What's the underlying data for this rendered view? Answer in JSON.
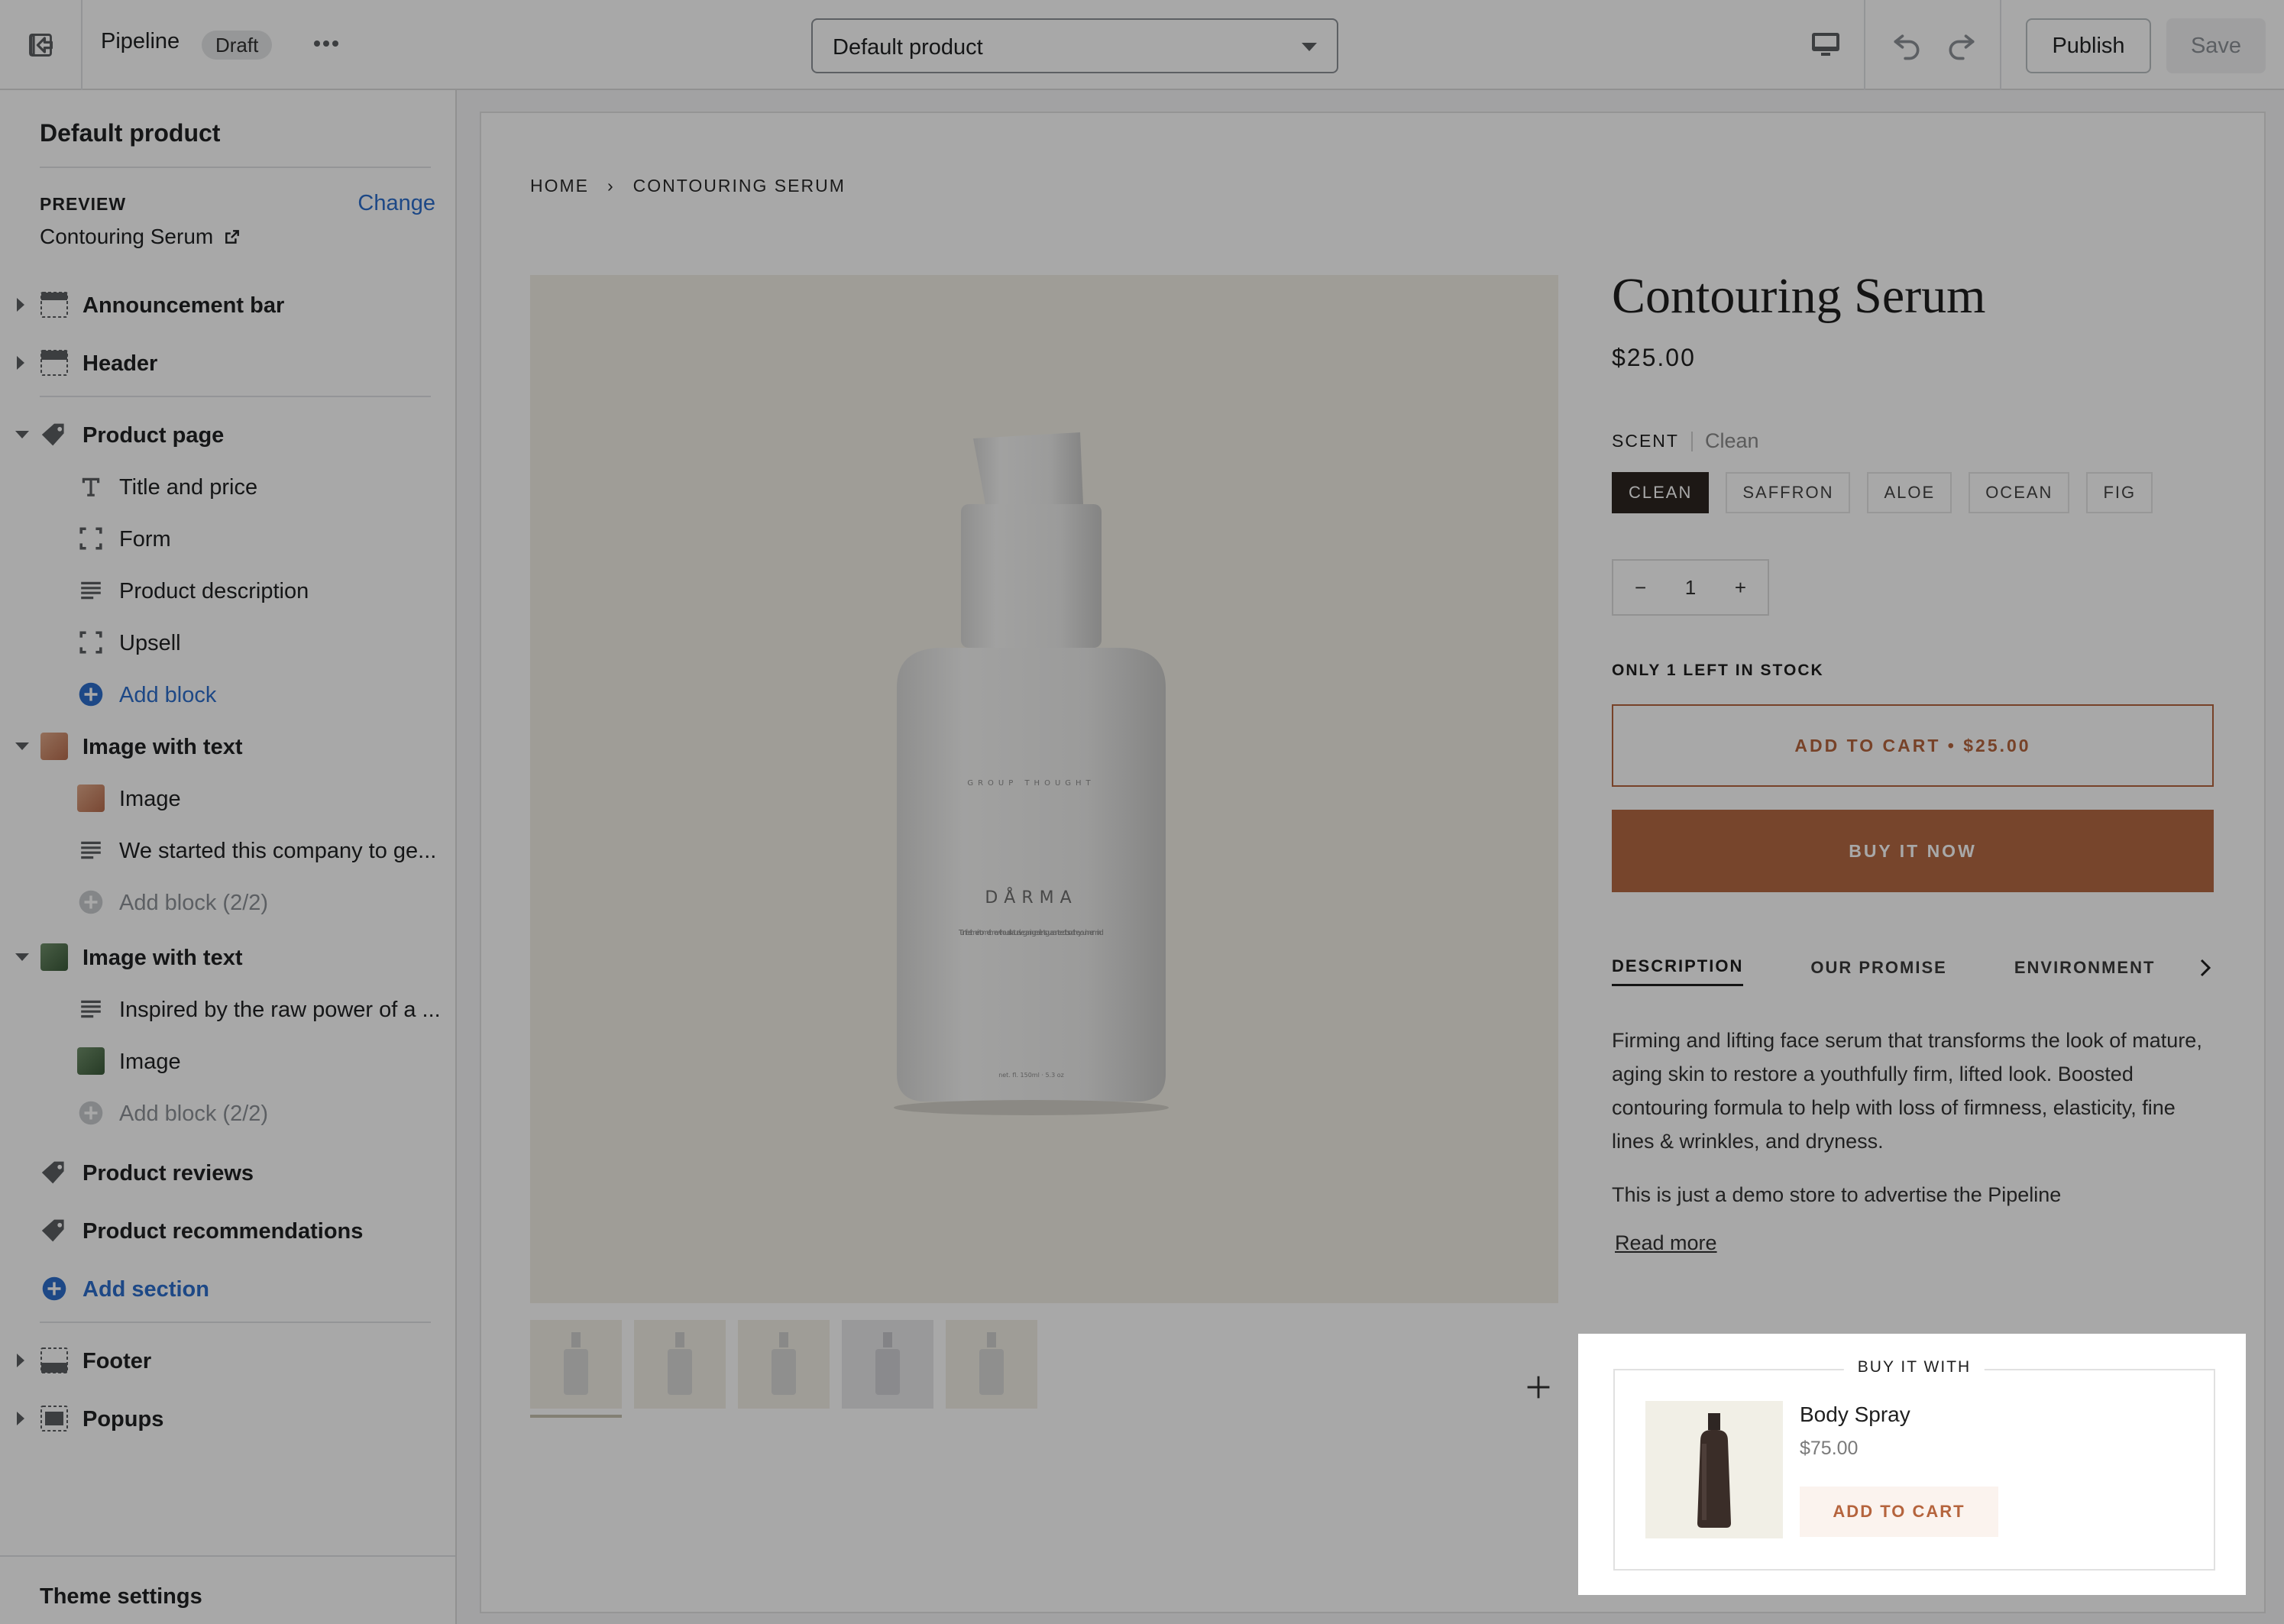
{
  "topbar": {
    "title": "Pipeline",
    "status_badge": "Draft",
    "template_select": "Default product",
    "publish_label": "Publish",
    "save_label": "Save"
  },
  "sidebar": {
    "heading": "Default product",
    "preview_label": "PREVIEW",
    "change_label": "Change",
    "preview_value": "Contouring Serum",
    "sections": {
      "announcement": "Announcement bar",
      "header": "Header",
      "product_page": "Product page",
      "product_blocks": [
        "Title and price",
        "Form",
        "Product description",
        "Upsell"
      ],
      "add_block": "Add block",
      "image_text_1": "Image with text",
      "image_text_1_blocks": [
        "Image",
        "We started this company to ge..."
      ],
      "add_block_limit": "Add block (2/2)",
      "image_text_2": "Image with text",
      "image_text_2_blocks": [
        "Inspired by the raw power of a ...",
        "Image"
      ],
      "product_reviews": "Product reviews",
      "product_recommendations": "Product recommendations",
      "add_section": "Add section",
      "footer": "Footer",
      "popups": "Popups"
    },
    "theme_settings": "Theme settings"
  },
  "store": {
    "breadcrumb": [
      "HOME",
      "›",
      "CONTOURING SERUM"
    ],
    "bottle_brand": "DÅRMA",
    "bottle_top_text": "GROUP THOUGHT",
    "bottle_copy": "Turn free time into me time with our all natural vegan ingredients guaranteed to soothe your inner mind",
    "bottle_volume": "net. fl. 150ml · 5.3 oz",
    "product_title": "Contouring Serum",
    "price": "$25.00",
    "option_name": "SCENT",
    "option_value": "Clean",
    "options": [
      "CLEAN",
      "SAFFRON",
      "ALOE",
      "OCEAN",
      "FIG"
    ],
    "quantity": "1",
    "qty_minus": "−",
    "qty_plus": "+",
    "stock_text": "ONLY 1 LEFT IN STOCK",
    "add_to_cart": "ADD TO CART • $25.00",
    "buy_now": "BUY IT NOW",
    "tabs": [
      "DESCRIPTION",
      "OUR PROMISE",
      "ENVIRONMENT"
    ],
    "description": [
      "Firming and lifting face serum that transforms the look of mature, aging skin to restore a youthfully firm, lifted look. Boosted contouring formula to help with loss of firmness, elasticity, fine lines & wrinkles, and dryness.",
      "This is just a demo store to advertise the Pipeline"
    ],
    "read_more": "Read more",
    "upsell": {
      "title": "BUY IT WITH",
      "product_name": "Body Spray",
      "price": "$75.00",
      "button": "ADD TO CART"
    }
  },
  "colors": {
    "accent_link": "#2c6ecb",
    "brand_terracotta": "#b56a43",
    "selected_swatch": "#2c2520"
  }
}
